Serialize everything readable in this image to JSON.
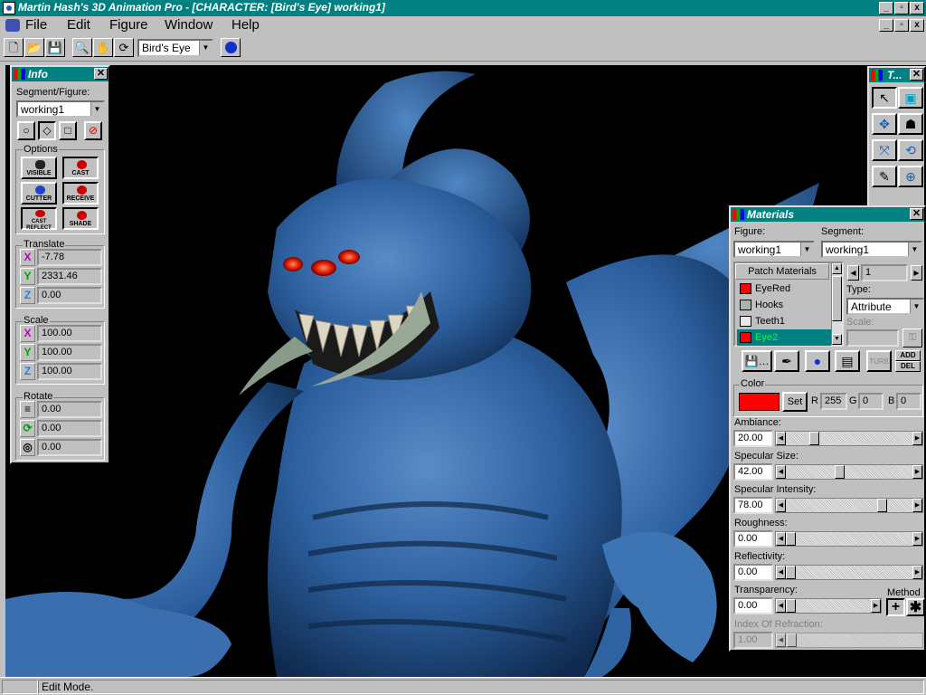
{
  "app": {
    "title": "Martin Hash's 3D Animation Pro - [CHARACTER: [Bird's Eye] working1]",
    "window_buttons": [
      "_",
      "▫",
      "x"
    ]
  },
  "menu": {
    "items": [
      "File",
      "Edit",
      "Figure",
      "Window",
      "Help"
    ]
  },
  "toolbar": {
    "view_select": "Bird's Eye"
  },
  "info_panel": {
    "title": "Info",
    "segment_label": "Segment/Figure:",
    "segment_value": "working1",
    "options_label": "Options",
    "option_buttons": [
      "VISIBLE",
      "CAST",
      "CUTTER",
      "RECEIVE",
      "CAST REFLECT",
      "SHADE"
    ],
    "translate_label": "Translate",
    "translate": {
      "x": "-7.78",
      "y": "2331.46",
      "z": "0.00"
    },
    "scale_label": "Scale",
    "scale": {
      "x": "100.00",
      "y": "100.00",
      "z": "100.00"
    },
    "rotate_label": "Rotate",
    "rotate": {
      "a": "0.00",
      "b": "0.00",
      "c": "0.00"
    },
    "axis_letters": {
      "x": "X",
      "y": "Y",
      "z": "Z"
    }
  },
  "tools_panel": {
    "title": "T..."
  },
  "materials_panel": {
    "title": "Materials",
    "figure_label": "Figure:",
    "figure_value": "working1",
    "segment_label": "Segment:",
    "segment_value": "working1",
    "list_header": "Patch Materials",
    "materials": [
      {
        "name": "EyeRed",
        "color": "#ff0000"
      },
      {
        "name": "Hooks",
        "color": "#a8b4a8"
      },
      {
        "name": "Teeth1",
        "color": "#e8e8e8"
      },
      {
        "name": "Eye2",
        "color": "#ff0000"
      }
    ],
    "selected_index": 3,
    "index_value": "1",
    "type_label": "Type:",
    "type_value": "Attribute",
    "scale_label": "Scale:",
    "add_label": "ADD",
    "del_label": "DEL",
    "turb_label": "TURB",
    "color_label": "Color",
    "set_label": "Set",
    "r_label": "R",
    "r_value": "255",
    "g_label": "G",
    "g_value": "0",
    "b_label": "B",
    "b_value": "0",
    "swatch_color": "#ff0000",
    "props": [
      {
        "label": "Ambiance:",
        "value": "20.00",
        "level": 0.2
      },
      {
        "label": "Specular Size:",
        "value": "42.00",
        "level": 0.42
      },
      {
        "label": "Specular Intensity:",
        "value": "78.00",
        "level": 0.78
      },
      {
        "label": "Roughness:",
        "value": "0.00",
        "level": 0
      },
      {
        "label": "Reflectivity:",
        "value": "0.00",
        "level": 0
      },
      {
        "label": "Transparency:",
        "value": "0.00",
        "level": 0
      }
    ],
    "method_label": "Method",
    "ior_label": "Index Of Refraction:",
    "ior_value": "1.00"
  },
  "status": {
    "mode": "Edit Mode."
  }
}
